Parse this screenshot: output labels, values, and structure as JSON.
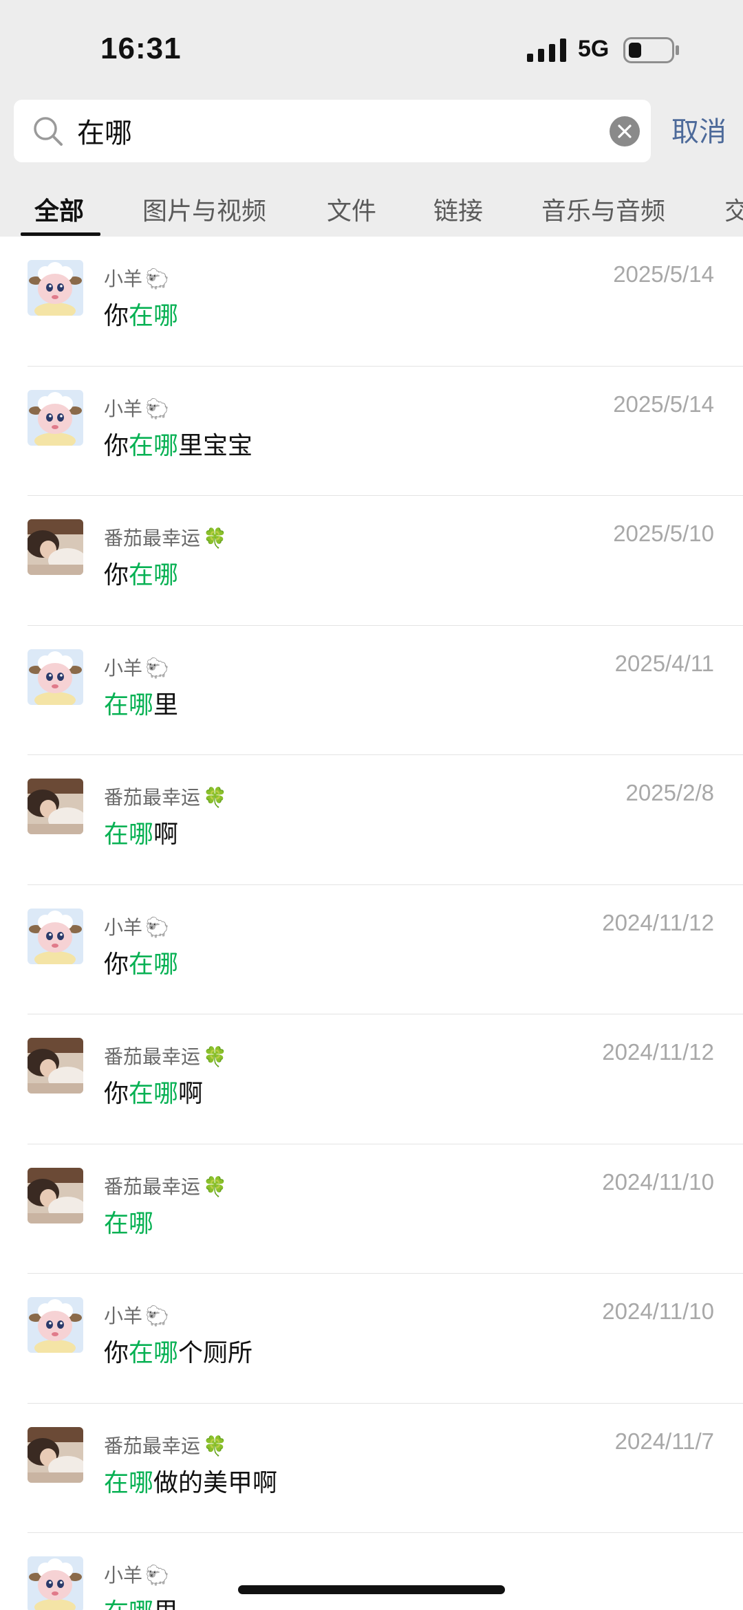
{
  "status_bar": {
    "time": "16:31",
    "network": "5G",
    "signal_icon": "cellular-signal-icon",
    "battery_icon": "battery-icon"
  },
  "search": {
    "query": "在哪",
    "cancel_label": "取消",
    "search_icon": "search-icon",
    "clear_icon": "clear-icon"
  },
  "tabs": [
    {
      "label": "全部",
      "active": true
    },
    {
      "label": "图片与视频",
      "active": false
    },
    {
      "label": "文件",
      "active": false
    },
    {
      "label": "链接",
      "active": false
    },
    {
      "label": "音乐与音频",
      "active": false
    },
    {
      "label": "交",
      "active": false
    }
  ],
  "colors": {
    "highlight": "#07b153",
    "cancel": "#4d6a9a",
    "date": "#a8a8a8",
    "header_bg": "#ededed"
  },
  "results": [
    {
      "sender": "小羊",
      "emoji": "🐑",
      "avatar": "sheep-avatar",
      "date": "2025/5/14",
      "pre": "你",
      "hl": "在哪",
      "post": ""
    },
    {
      "sender": "小羊",
      "emoji": "🐑",
      "avatar": "sheep-avatar",
      "date": "2025/5/14",
      "pre": "你",
      "hl": "在哪",
      "post": "里宝宝"
    },
    {
      "sender": "番茄最幸运",
      "emoji": "🍀",
      "avatar": "photo-avatar",
      "date": "2025/5/10",
      "pre": "你",
      "hl": "在哪",
      "post": ""
    },
    {
      "sender": "小羊",
      "emoji": "🐑",
      "avatar": "sheep-avatar",
      "date": "2025/4/11",
      "pre": "",
      "hl": "在哪",
      "post": "里"
    },
    {
      "sender": "番茄最幸运",
      "emoji": "🍀",
      "avatar": "photo-avatar",
      "date": "2025/2/8",
      "pre": "",
      "hl": "在哪",
      "post": "啊"
    },
    {
      "sender": "小羊",
      "emoji": "🐑",
      "avatar": "sheep-avatar",
      "date": "2024/11/12",
      "pre": "你",
      "hl": "在哪",
      "post": ""
    },
    {
      "sender": "番茄最幸运",
      "emoji": "🍀",
      "avatar": "photo-avatar",
      "date": "2024/11/12",
      "pre": "你",
      "hl": "在哪",
      "post": "啊"
    },
    {
      "sender": "番茄最幸运",
      "emoji": "🍀",
      "avatar": "photo-avatar",
      "date": "2024/11/10",
      "pre": "",
      "hl": "在哪",
      "post": ""
    },
    {
      "sender": "小羊",
      "emoji": "🐑",
      "avatar": "sheep-avatar",
      "date": "2024/11/10",
      "pre": "你",
      "hl": "在哪",
      "post": "个厕所"
    },
    {
      "sender": "番茄最幸运",
      "emoji": "🍀",
      "avatar": "photo-avatar",
      "date": "2024/11/7",
      "pre": "",
      "hl": "在哪",
      "post": "做的美甲啊"
    },
    {
      "sender": "小羊",
      "emoji": "🐑",
      "avatar": "sheep-avatar",
      "date": "",
      "pre": "",
      "hl": "在哪",
      "post": "里"
    }
  ]
}
